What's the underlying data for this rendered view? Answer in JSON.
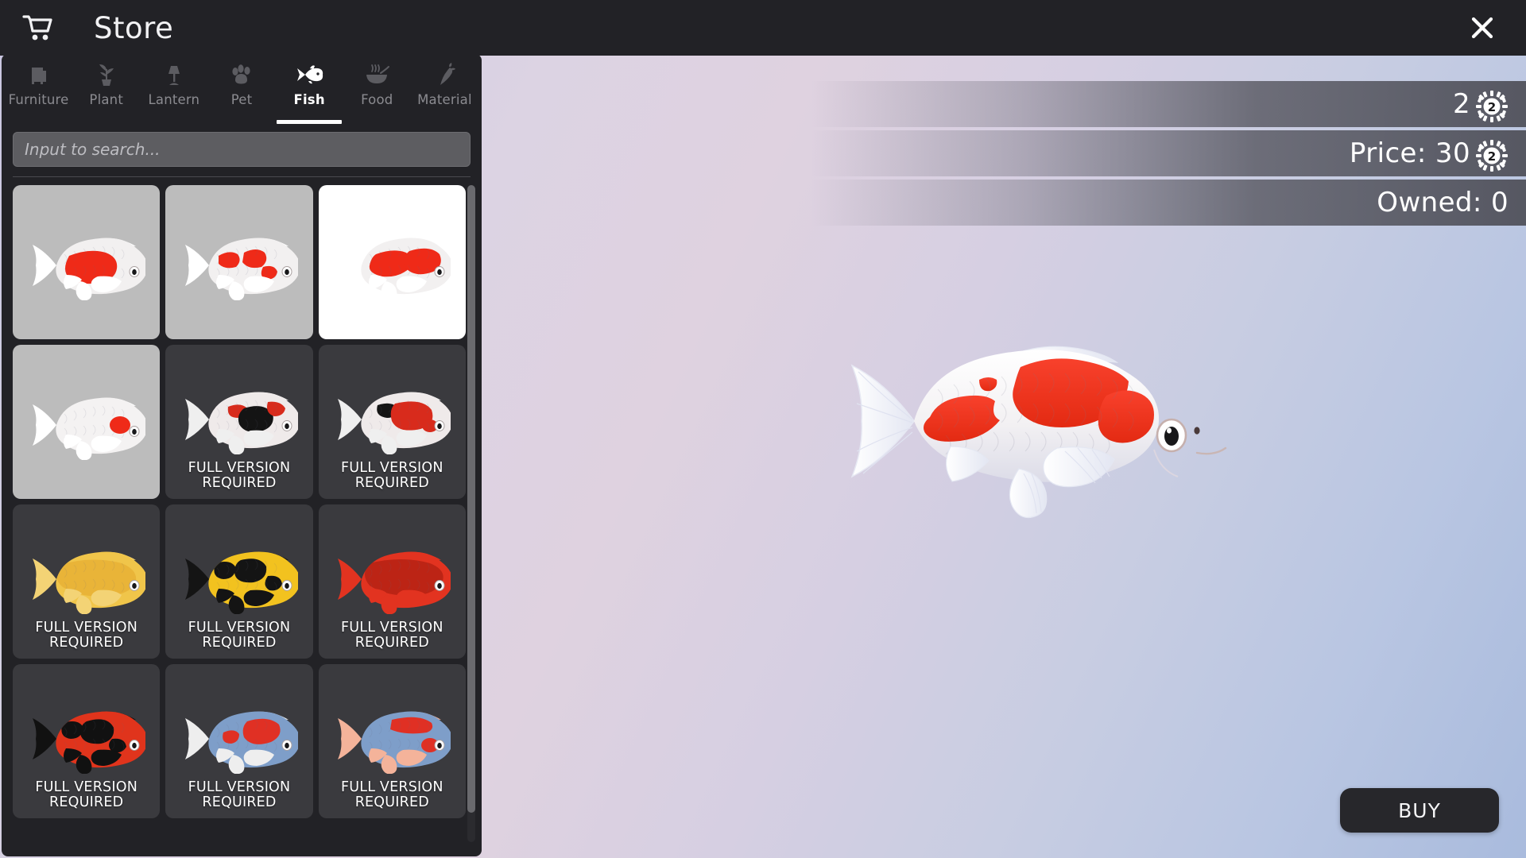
{
  "window": {
    "title": "Store",
    "cart_icon": "shopping-cart-icon",
    "close_icon": "close-icon"
  },
  "tabs": [
    {
      "label": "Furniture",
      "icon": "furniture-icon",
      "active": false
    },
    {
      "label": "Plant",
      "icon": "plant-icon",
      "active": false
    },
    {
      "label": "Lantern",
      "icon": "lantern-icon",
      "active": false
    },
    {
      "label": "Pet",
      "icon": "paw-icon",
      "active": false
    },
    {
      "label": "Fish",
      "icon": "fish-icon",
      "active": true
    },
    {
      "label": "Food",
      "icon": "food-bowl-icon",
      "active": false
    },
    {
      "label": "Material",
      "icon": "carrot-icon",
      "active": false
    }
  ],
  "search": {
    "placeholder": "Input to search...",
    "value": ""
  },
  "grid": {
    "locked_label_line1": "FULL VERSION",
    "locked_label_line2": "REQUIRED",
    "items": [
      {
        "name": "koi-red-white-a",
        "state": "unlocked",
        "locked": false,
        "selected": false,
        "body": "#f2f0f0",
        "patch": "#ef2a18",
        "pattern": "kohaku-large",
        "fin": "#ffffff"
      },
      {
        "name": "koi-red-white-b",
        "state": "unlocked",
        "locked": false,
        "selected": false,
        "body": "#f2f0f0",
        "patch": "#ef2a18",
        "pattern": "kohaku-spots",
        "fin": "#ffffff"
      },
      {
        "name": "koi-red-white-c",
        "state": "selected",
        "locked": false,
        "selected": true,
        "body": "#f2f0f0",
        "patch": "#ef2a18",
        "pattern": "kohaku-mixed",
        "fin": "#ffffff"
      },
      {
        "name": "koi-white-red-head",
        "state": "unlocked",
        "locked": false,
        "selected": false,
        "body": "#f4f2f2",
        "patch": "#ef2a18",
        "pattern": "tancho",
        "fin": "#ffffff"
      },
      {
        "name": "koi-showa-black",
        "state": "locked",
        "locked": true,
        "selected": false,
        "body": "#efeaea",
        "patch": "#d82b1c",
        "pattern": "showa",
        "fin": "#efefef"
      },
      {
        "name": "koi-showa-red",
        "state": "locked",
        "locked": true,
        "selected": false,
        "body": "#efeaea",
        "patch": "#d82b1c",
        "pattern": "showa-red",
        "fin": "#efefef"
      },
      {
        "name": "koi-yellow-gold",
        "state": "locked",
        "locked": true,
        "selected": false,
        "body": "#f0c54a",
        "patch": "#e3a52a",
        "pattern": "solid-gold",
        "fin": "#f3d375"
      },
      {
        "name": "koi-black-yellow",
        "state": "locked",
        "locked": true,
        "selected": false,
        "body": "#f2c21f",
        "patch": "#141414",
        "pattern": "utsuri",
        "fin": "#141414"
      },
      {
        "name": "koi-deep-red",
        "state": "locked",
        "locked": true,
        "selected": false,
        "body": "#e23320",
        "patch": "#8d1208",
        "pattern": "solid-red",
        "fin": "#e23320"
      },
      {
        "name": "koi-red-black",
        "state": "locked",
        "locked": true,
        "selected": false,
        "body": "#e0341c",
        "patch": "#111111",
        "pattern": "hi-utsuri",
        "fin": "#111111"
      },
      {
        "name": "koi-blue-red-a",
        "state": "locked",
        "locked": true,
        "selected": false,
        "body": "#7e9ec9",
        "patch": "#e03024",
        "pattern": "asagi-a",
        "fin": "#eeeeee"
      },
      {
        "name": "koi-blue-red-b",
        "state": "locked",
        "locked": true,
        "selected": false,
        "body": "#7e9ec9",
        "patch": "#e03024",
        "pattern": "asagi-b",
        "fin": "#f4b39a"
      }
    ]
  },
  "info": {
    "currency_amount": "2",
    "price_label": "Price: 30",
    "owned_label": "Owned: 0",
    "coin_icon": "coin-icon",
    "coin_glyph": "2"
  },
  "preview": {
    "item": "koi-red-white-c",
    "body_color": "#f4f1f1",
    "patch_color": "#f03522",
    "fin_color": "#ffffff",
    "eye_color": "#1a1a1a"
  },
  "actions": {
    "buy_label": "BUY"
  },
  "colors": {
    "panel_bg": "#222226",
    "topbar_bg": "#222226",
    "cell_locked_bg": "#3a3a3e",
    "cell_unlocked_bg": "#bcbcbc",
    "cell_selected_bg": "#ffffff",
    "accent_white": "#ffffff",
    "buy_bg": "#27272b"
  }
}
